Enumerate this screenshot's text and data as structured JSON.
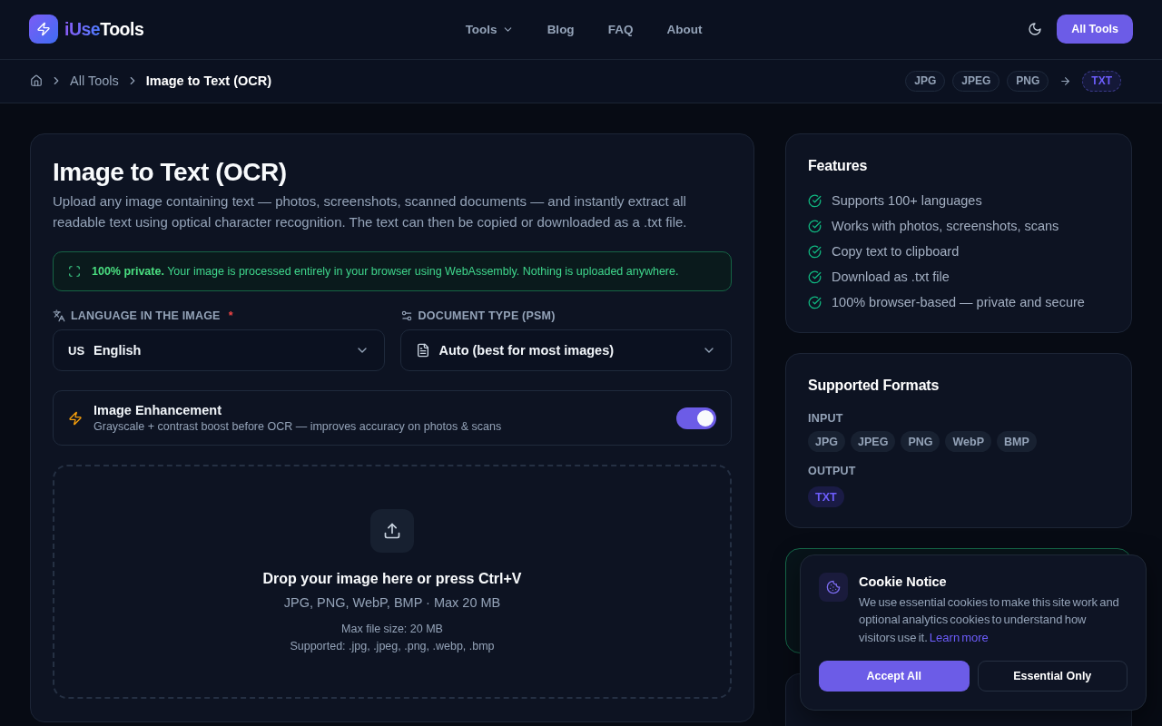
{
  "header": {
    "logo": {
      "accent": "iUse",
      "text": "Tools"
    },
    "nav": [
      {
        "label": "Tools",
        "kind": "menu"
      },
      {
        "label": "Blog",
        "kind": "link"
      },
      {
        "label": "FAQ",
        "kind": "link"
      },
      {
        "label": "About",
        "kind": "link"
      }
    ],
    "cta": "All Tools"
  },
  "breadcrumb": {
    "items": [
      {
        "label": "All Tools",
        "current": false
      },
      {
        "label": "Image to Text (OCR)",
        "current": true
      }
    ],
    "formats": [
      {
        "label": "JPG",
        "kind": "input"
      },
      {
        "label": "JPEG",
        "kind": "input"
      },
      {
        "label": "PNG",
        "kind": "input"
      },
      {
        "label": "TXT",
        "kind": "output"
      }
    ]
  },
  "tool": {
    "title": "Image to Text (OCR)",
    "description": "Upload any image containing text — photos, screenshots, scanned documents — and instantly extract all readable text using optical character recognition. The text can then be copied or downloaded as a .txt file.",
    "privacy_notice": "**100% private.** Your image is processed entirely in your browser using WebAssembly. Nothing is uploaded anywhere.",
    "fields": [
      {
        "kind": "language",
        "label": "LANGUAGE IN THE IMAGE",
        "required_mark": "*",
        "flag": "US",
        "value": "English"
      },
      {
        "kind": "document",
        "label": "DOCUMENT TYPE (PSM)",
        "value": "Auto (best for most images)"
      }
    ],
    "enhancement": {
      "title": "Image Enhancement",
      "description": "Grayscale + contrast boost before OCR — improves accuracy on photos & scans",
      "on": true
    },
    "dropzone": {
      "title": "Drop your image here or press Ctrl+V",
      "formats": "JPG, PNG, WebP, BMP · Max 20 MB",
      "max_size": "Max file size: 20 MB",
      "supported": "Supported: .jpg, .jpeg, .png, .webp, .bmp"
    }
  },
  "features": {
    "title": "Features",
    "items": [
      "Supports 100+ languages",
      "Works with photos, screenshots, scans",
      "Copy text to clipboard",
      "Download as .txt file",
      "100% browser-based — private and secure"
    ]
  },
  "formats": {
    "title": "Supported Formats",
    "input_label": "INPUT",
    "inputs": [
      "JPG",
      "JPEG",
      "PNG",
      "WebP",
      "BMP"
    ],
    "output_label": "OUTPUT",
    "outputs": [
      "TXT"
    ]
  },
  "cookie_notice": {
    "title": "Cookie Notice",
    "text": "We use essential cookies to make this site work and optional analytics cookies to understand how visitors use it.",
    "link": "Learn more",
    "buttons": [
      {
        "label": "Accept All",
        "kind": "primary"
      },
      {
        "label": "Essential Only",
        "kind": "secondary"
      }
    ]
  }
}
